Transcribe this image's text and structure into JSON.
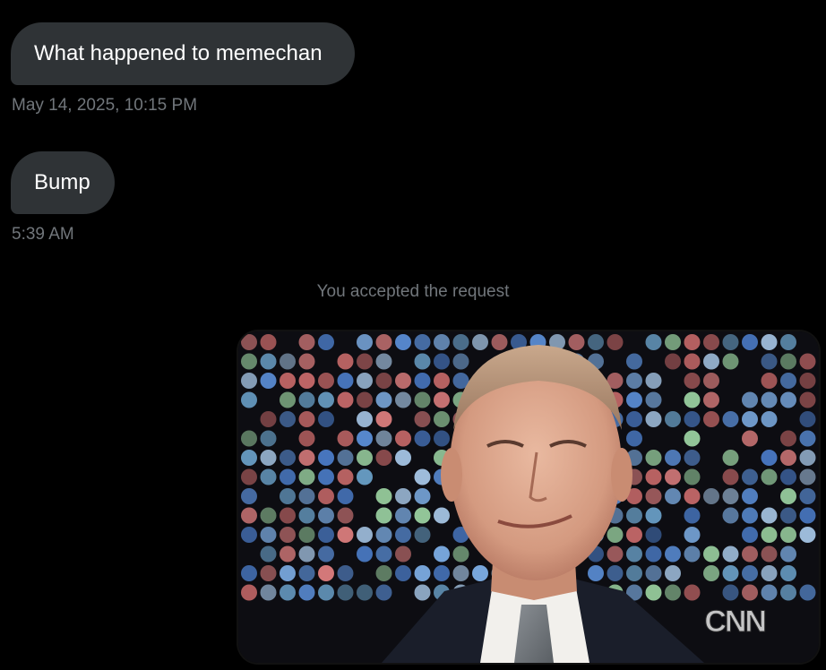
{
  "conversation": {
    "messages": [
      {
        "text": "What happened to memechan",
        "timestamp": "May 14, 2025, 10:15 PM"
      },
      {
        "text": "Bump",
        "timestamp": "5:39 AM"
      }
    ],
    "system_message": "You accepted the request",
    "media": {
      "icon": "video-still-image",
      "logo_text": "CNN"
    }
  },
  "colors": {
    "background": "#000000",
    "bubble": "#2f3336",
    "bubble_text": "#ffffff",
    "muted_text": "#71767b"
  }
}
